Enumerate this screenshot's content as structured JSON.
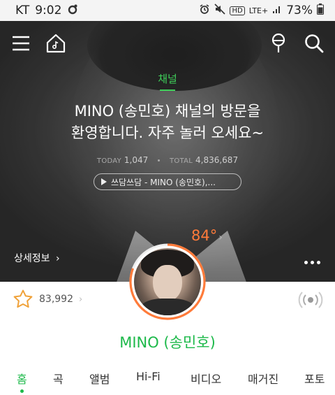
{
  "status_bar": {
    "carrier": "KT",
    "time": "9:02",
    "network": "LTE+",
    "hd": "HD",
    "battery": "73%"
  },
  "header": {
    "icons": [
      "menu-icon",
      "home-icon",
      "microphone-icon",
      "search-icon"
    ]
  },
  "hero": {
    "channel_label": "채널",
    "welcome_line1": "MINO (송민호) 채널의 방문을",
    "welcome_line2": "환영합니다. 자주 놀러 오세요~",
    "today_label": "TODAY",
    "today_count": "1,047",
    "total_label": "TOTAL",
    "total_count": "4,836,687",
    "song_title": "쓰담쓰담 - MINO (송민호),...",
    "detail_link": "상세정보",
    "temperature": "84°"
  },
  "profile": {
    "fan_count": "83,992",
    "artist_name": "MINO (송민호)"
  },
  "tabs": [
    "홈",
    "곡",
    "앨범",
    "Hi-Fi",
    "비디오",
    "매거진",
    "포토"
  ],
  "colors": {
    "accent_green": "#1db94a",
    "temperature_orange": "#ff7b3a"
  }
}
